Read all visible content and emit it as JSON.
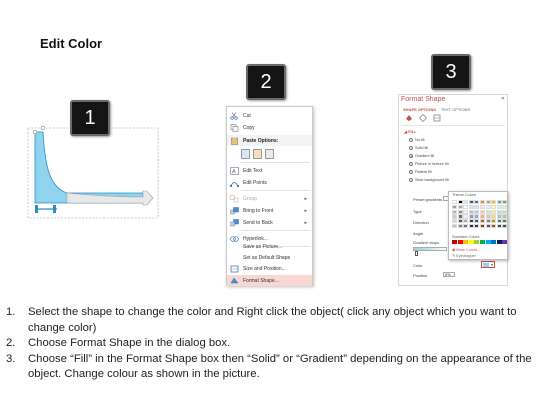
{
  "title": "Edit Color",
  "badges": [
    "1",
    "2",
    "3"
  ],
  "context_menu": {
    "items": [
      {
        "label": "Cut",
        "icon": "scissors-icon",
        "state": "normal"
      },
      {
        "label": "Copy",
        "icon": "copy-icon",
        "state": "normal"
      },
      {
        "label": "Paste Options:",
        "icon": "clipboard-icon",
        "state": "header"
      },
      {
        "label": "Edit Text",
        "icon": "edit-text-icon",
        "state": "normal"
      },
      {
        "label": "Edit Points",
        "icon": "edit-points-icon",
        "state": "normal"
      },
      {
        "label": "Group",
        "icon": "group-icon",
        "state": "disabled",
        "submenu": true
      },
      {
        "label": "Bring to Front",
        "icon": "bring-front-icon",
        "state": "normal",
        "submenu": true
      },
      {
        "label": "Send to Back",
        "icon": "send-back-icon",
        "state": "normal",
        "submenu": true
      },
      {
        "label": "Hyperlink...",
        "icon": "hyperlink-icon",
        "state": "normal"
      },
      {
        "label": "Save as Picture...",
        "icon": "",
        "state": "normal"
      },
      {
        "label": "Set as Default Shape",
        "icon": "",
        "state": "normal"
      },
      {
        "label": "Size and Position...",
        "icon": "size-position-icon",
        "state": "normal"
      },
      {
        "label": "Format Shape...",
        "icon": "format-shape-icon",
        "state": "highlight"
      }
    ]
  },
  "format_pane": {
    "title": "Format Shape",
    "close": "✕",
    "tabs": [
      "SHAPE OPTIONS",
      "TEXT OPTIONS"
    ],
    "section": "◢ FILL",
    "fill_options": [
      {
        "label": "No fill",
        "selected": false
      },
      {
        "label": "Solid fill",
        "selected": false
      },
      {
        "label": "Gradient fill",
        "selected": true
      },
      {
        "label": "Picture or texture fill",
        "selected": false
      },
      {
        "label": "Pattern fill",
        "selected": false
      },
      {
        "label": "Slide background fill",
        "selected": false
      }
    ],
    "properties": [
      "Preset gradients",
      "Type",
      "Direction",
      "Angle",
      "Gradient stops",
      "Color",
      "Position"
    ],
    "position_value": "0%"
  },
  "color_popup": {
    "theme_label": "Theme Colors",
    "standard_label": "Standard Colors",
    "more_colors": "More Colors...",
    "eyedropper": "Eyedropper",
    "theme_top": [
      "#ffffff",
      "#000000",
      "#e7e6e6",
      "#44546a",
      "#4472c4",
      "#ed7d31",
      "#a5a5a5",
      "#ffc000",
      "#5b9bd5",
      "#70ad47"
    ],
    "standard": [
      "#c00000",
      "#ff0000",
      "#ffc000",
      "#ffff00",
      "#92d050",
      "#00b050",
      "#00b0f0",
      "#0070c0",
      "#002060",
      "#7030a0"
    ]
  },
  "colors": {
    "accent": "#c0504d",
    "shape_fill": "#8fd3ee",
    "shape_stroke": "#2b8fc4"
  },
  "instructions": [
    {
      "num": "1.",
      "text": "Select the shape to change the color and Right click the object( click any object which you want to change color)"
    },
    {
      "num": "2.",
      "text": "Choose Format Shape in the dialog box."
    },
    {
      "num": "3.",
      "text": "Choose “Fill” in the Format Shape box then “Solid” or “Gradient” depending on the appearance of the object. Change colour as shown in the picture."
    }
  ]
}
